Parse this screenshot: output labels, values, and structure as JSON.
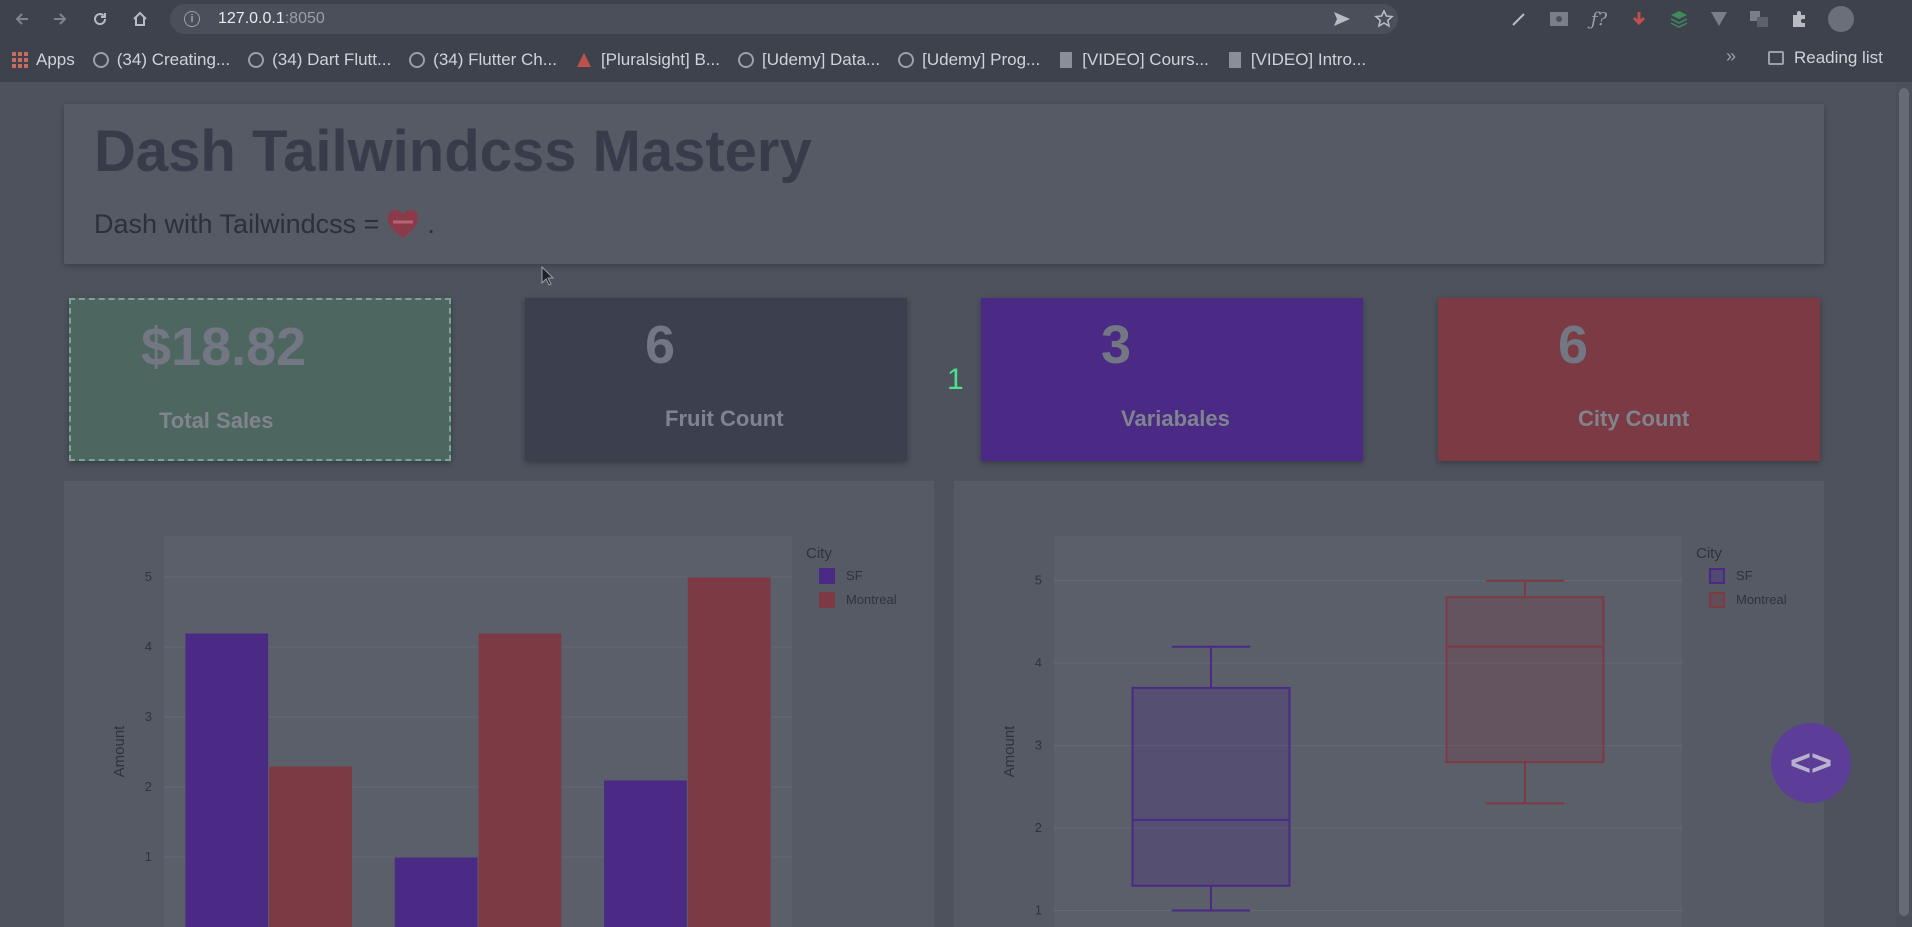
{
  "browser": {
    "url_host": "127.0.0.1",
    "url_port": ":8050",
    "info_glyph": "i",
    "back_icon": "back-arrow-icon",
    "forward_icon": "forward-arrow-icon",
    "reload_icon": "reload-icon",
    "home_icon": "home-icon",
    "bookmarks": [
      {
        "label": "Apps",
        "icon": "apps-grid-icon"
      },
      {
        "label": "(34) Creating...",
        "icon": "globe-icon"
      },
      {
        "label": "(34) Dart Flutt...",
        "icon": "globe-icon"
      },
      {
        "label": "(34) Flutter Ch...",
        "icon": "globe-icon"
      },
      {
        "label": "[Pluralsight] B...",
        "icon": "pluralsight-icon"
      },
      {
        "label": "[Udemy] Data...",
        "icon": "globe-icon"
      },
      {
        "label": "[Udemy] Prog...",
        "icon": "globe-icon"
      },
      {
        "label": "[VIDEO] Cours...",
        "icon": "page-icon"
      },
      {
        "label": "[VIDEO] Intro...",
        "icon": "page-icon"
      }
    ],
    "more_bookmarks": "»",
    "reading_list": "Reading list"
  },
  "header": {
    "title": "Dash Tailwindcss Mastery",
    "subtitle": "Dash with Tailwindcss = ",
    "subtitle_end": "."
  },
  "stats": [
    {
      "value": "$18.82",
      "label": "Total Sales",
      "color": "#4e6660"
    },
    {
      "value": "6",
      "label": "Fruit Count",
      "color": "#3b3f4e"
    },
    {
      "value": "3",
      "label": "Variabales",
      "color": "#4b2a86"
    },
    {
      "value": "6",
      "label": "City Count",
      "color": "#7c3a45"
    }
  ],
  "frame_number": "1",
  "fab_label": "<>",
  "colors": {
    "sf": "#4b2a86",
    "montreal": "#7c3a45"
  },
  "chart_data": [
    {
      "type": "bar",
      "title": "",
      "xlabel": "",
      "ylabel": "Amount",
      "legend_title": "City",
      "legend_position": "top-right",
      "ylim": [
        0,
        5.3
      ],
      "yticks": [
        1,
        2,
        3,
        4,
        5
      ],
      "categories": [
        "",
        "",
        ""
      ],
      "series": [
        {
          "name": "SF",
          "values": [
            4.2,
            1.0,
            2.1
          ],
          "color": "#4b2a86"
        },
        {
          "name": "Montreal",
          "values": [
            2.3,
            4.2,
            5.0
          ],
          "color": "#7c3a45"
        }
      ]
    },
    {
      "type": "box",
      "title": "",
      "xlabel": "",
      "ylabel": "Amount",
      "legend_title": "City",
      "legend_position": "top-right",
      "ylim": [
        0.8,
        5.3
      ],
      "yticks": [
        1,
        2,
        3,
        4,
        5
      ],
      "series": [
        {
          "name": "SF",
          "min": 1.0,
          "q1": 1.3,
          "median": 2.1,
          "q3": 3.7,
          "max": 4.2,
          "color": "#4b2a86"
        },
        {
          "name": "Montreal",
          "min": 2.3,
          "q1": 2.8,
          "median": 4.2,
          "q3": 4.8,
          "max": 5.0,
          "color": "#7c3a45"
        }
      ]
    }
  ]
}
